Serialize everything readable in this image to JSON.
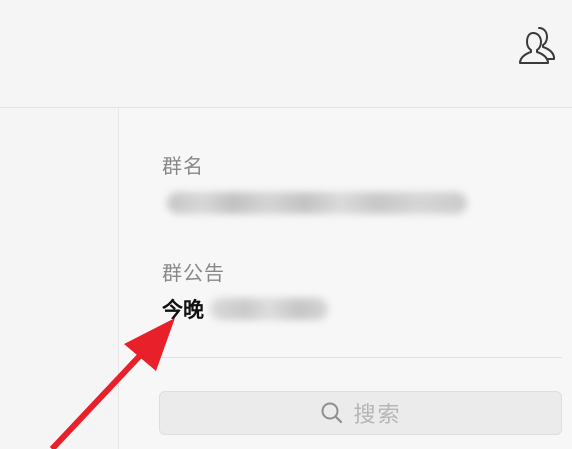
{
  "header": {
    "members_icon": "group-members-icon"
  },
  "group_info": {
    "name_label": "群名",
    "name_value": "",
    "notice_label": "群公告",
    "notice_value": "今晚"
  },
  "search": {
    "icon": "search-icon",
    "placeholder": "搜索"
  },
  "annotation": {
    "arrow_color": "#e8202a"
  }
}
